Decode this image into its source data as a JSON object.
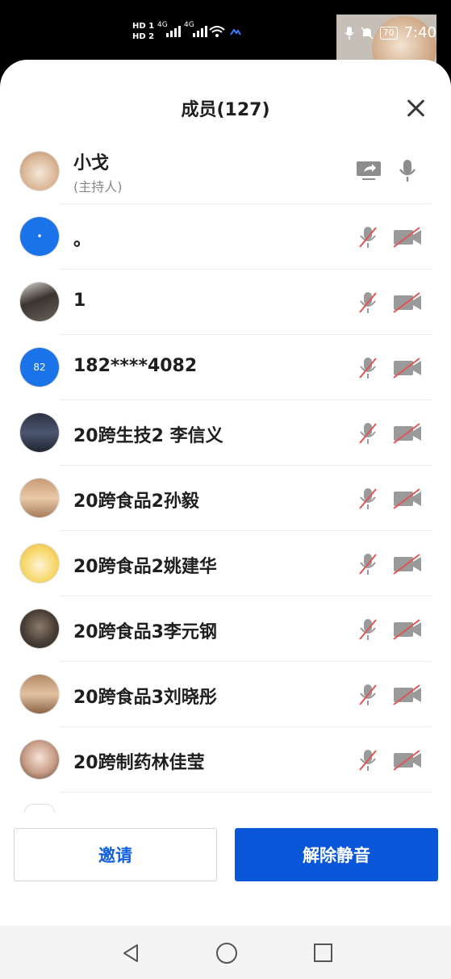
{
  "status_bar": {
    "hd1": "HD 1",
    "hd2": "HD 2",
    "net1": "4G",
    "net2": "4G",
    "battery": "70",
    "time": "7:40"
  },
  "header": {
    "title": "成员(127)"
  },
  "members": [
    {
      "name": "小戈",
      "role": "(主持人)"
    },
    {
      "name": "。",
      "avatar_text": "•"
    },
    {
      "name": "1"
    },
    {
      "name": "182****4082",
      "avatar_text": "82"
    },
    {
      "name": "20跨生技2 李信义"
    },
    {
      "name": "20跨食品2孙毅"
    },
    {
      "name": "20跨食品2姚建华"
    },
    {
      "name": "20跨食品3李元钢"
    },
    {
      "name": "20跨食品3刘晓彤"
    },
    {
      "name": "20跨制药林佳莹"
    }
  ],
  "buttons": {
    "invite": "邀请",
    "unmute_all": "解除静音"
  },
  "colors": {
    "primary_blue": "#0a56d8",
    "muted_red": "#e05555",
    "avatar_blue": "#1a73e8"
  }
}
